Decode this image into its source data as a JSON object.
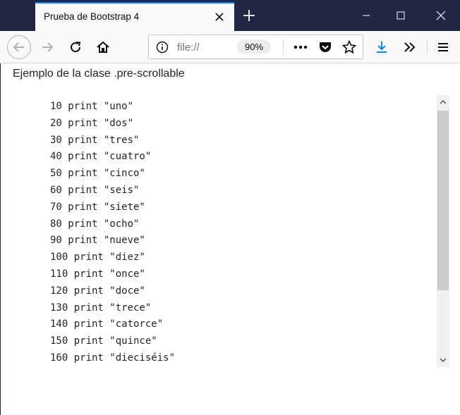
{
  "browser": {
    "tab_title": "Prueba de Bootstrap 4",
    "url": "file://",
    "zoom": "90%"
  },
  "page": {
    "heading": "Ejemplo de la clase .pre-scrollable",
    "code_lines": [
      "10 print \"uno\"",
      "20 print \"dos\"",
      "30 print \"tres\"",
      "40 print \"cuatro\"",
      "50 print \"cinco\"",
      "60 print \"seis\"",
      "70 print \"siete\"",
      "80 print \"ocho\"",
      "90 print \"nueve\"",
      "100 print \"diez\"",
      "110 print \"once\"",
      "120 print \"doce\"",
      "130 print \"trece\"",
      "140 print \"catorce\"",
      "150 print \"quince\"",
      "160 print \"dieciséis\""
    ]
  },
  "colors": {
    "titlebar": "#1f2745",
    "accent": "#0a84ff",
    "download_icon": "#0a84ff"
  }
}
